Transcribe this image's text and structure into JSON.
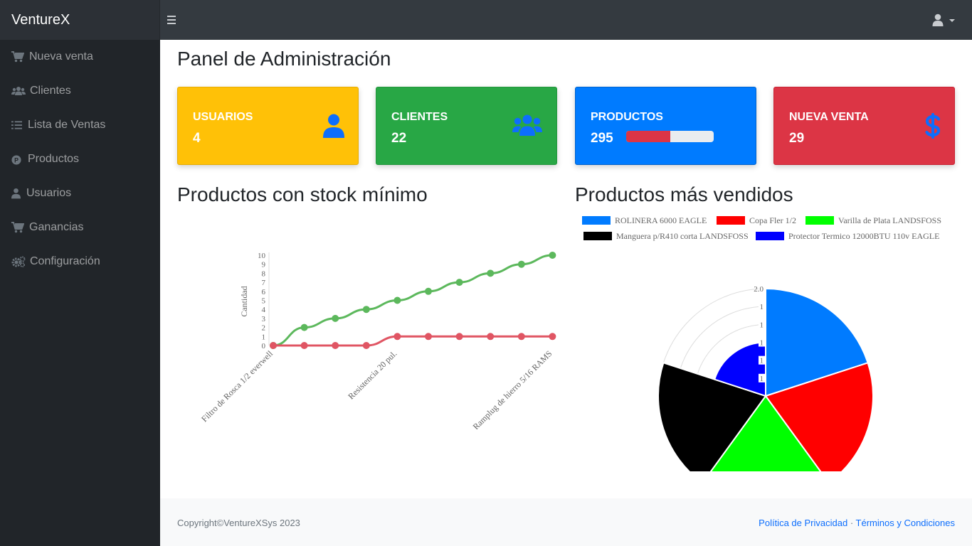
{
  "brand": "VentureX",
  "sidebar": {
    "items": [
      {
        "label": "Nueva venta",
        "icon": "cart-icon"
      },
      {
        "label": "Clientes",
        "icon": "users-icon"
      },
      {
        "label": "Lista de Ventas",
        "icon": "list-icon"
      },
      {
        "label": "Productos",
        "icon": "product-p-icon"
      },
      {
        "label": "Usuarios",
        "icon": "user-icon"
      },
      {
        "label": "Ganancias",
        "icon": "cart-icon"
      },
      {
        "label": "Configuración",
        "icon": "gears-icon"
      }
    ]
  },
  "main": {
    "title": "Panel de Administración",
    "cards": [
      {
        "title": "USUARIOS",
        "value": "4",
        "color": "#ffc107",
        "icon": "user-icon"
      },
      {
        "title": "CLIENTES",
        "value": "22",
        "color": "#28a745",
        "icon": "users-icon"
      },
      {
        "title": "PRODUCTOS",
        "value": "295",
        "color": "#007bff",
        "icon": "progress-bar",
        "progress": 0.5
      },
      {
        "title": "NUEVA VENTA",
        "value": "29",
        "color": "#dc3545",
        "icon": "dollar-icon"
      }
    ],
    "stock_title": "Productos con stock mínimo",
    "sold_title": "Productos más vendidos"
  },
  "chart_data": [
    {
      "type": "line",
      "title": "",
      "ylabel": "Cantidad",
      "ylim": [
        0,
        10
      ],
      "y_ticks": [
        "0",
        "1",
        "2",
        "3",
        "4",
        "5",
        "6",
        "7",
        "8",
        "9",
        "10"
      ],
      "x_tick_labels_shown": [
        "Filtro de Rosca 1/2 everwell",
        "Resistencia 20 pul.",
        "Ramplug de hierro 5/16 RAMS"
      ],
      "series": [
        {
          "color": "#5cb85c",
          "values": [
            0,
            2,
            3,
            4,
            5,
            6,
            7,
            8,
            9,
            10
          ]
        },
        {
          "color": "#e05563",
          "values": [
            0,
            0,
            0,
            0,
            1,
            1,
            1,
            1,
            1,
            1
          ]
        }
      ]
    },
    {
      "type": "pie",
      "subtype": "polar-area",
      "legend": "top",
      "r_ticks": [
        "1",
        "1",
        "1",
        "1",
        "1",
        "2.0"
      ],
      "categories": [
        "ROLINERA 6000 EAGLE",
        "Copa Fler 1/2",
        "Varilla de Plata LANDSFOSS",
        "Manguera p/R410 corta LANDSFOSS",
        "Protector Termico 12000BTU 110v EAGLE"
      ],
      "values": [
        2,
        2,
        2,
        2,
        1
      ],
      "colors": [
        "#007bff",
        "#ff0000",
        "#00ff00",
        "#000000",
        "#0000ff"
      ]
    }
  ],
  "footer": {
    "copyright": "Copyright©VentureXSys 2023",
    "privacy": "Política de Privacidad",
    "separator": "·",
    "terms": "Términos y Condiciones"
  }
}
